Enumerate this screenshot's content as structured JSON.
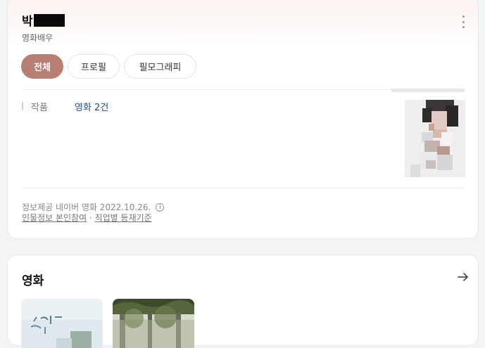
{
  "profile": {
    "name": "박",
    "occupation": "영화배우",
    "tabs": [
      {
        "label": "전체",
        "active": true
      },
      {
        "label": "프로필",
        "active": false
      },
      {
        "label": "필모그래피",
        "active": false
      }
    ],
    "works_label": "작품",
    "works_value": "영화 2건",
    "updated": "정보제공 네이버 영화 2022.10.26.",
    "info_icon": "i",
    "links": {
      "person_info": "인물정보 본인참여",
      "separator": " · ",
      "job_criteria": "직업별 등재기준"
    }
  },
  "movies": {
    "title": "영화",
    "arrow_icon": "arrow-right-icon"
  },
  "colors": {
    "accent": "#b77e73",
    "link": "#1a4e8c"
  }
}
